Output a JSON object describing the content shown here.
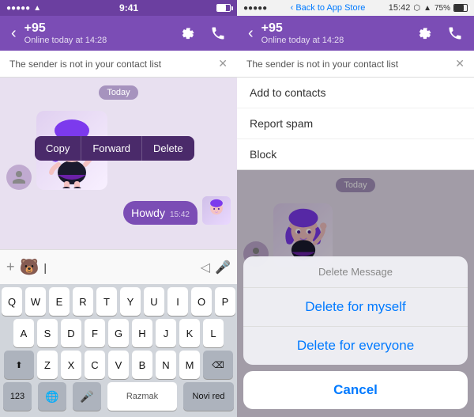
{
  "left": {
    "statusBar": {
      "signal": "●●●●●",
      "time": "9:41",
      "wifi": "WiFi",
      "battery": "battery"
    },
    "header": {
      "back": "‹",
      "contactName": "+95",
      "onlineStatus": "Online today at 14:28",
      "settingsIcon": "⚙",
      "callIcon": "📞"
    },
    "notification": "The sender is not in your contact list",
    "dateBadge": "Today",
    "contextMenu": {
      "copy": "Copy",
      "forward": "Forward",
      "delete": "Delete"
    },
    "outgoingMsg": "Howdy",
    "outgoingTime": "15:42",
    "inputPlaceholder": "|",
    "keyboard": {
      "row1": [
        "Q",
        "W",
        "E",
        "R",
        "T",
        "Y",
        "U",
        "I",
        "O",
        "P"
      ],
      "row2": [
        "A",
        "S",
        "D",
        "F",
        "G",
        "H",
        "J",
        "K",
        "L"
      ],
      "row3": [
        "Z",
        "X",
        "C",
        "V",
        "B",
        "N",
        "M"
      ],
      "spaceLabel": "Razmak",
      "returnLabel": "Novi red"
    }
  },
  "right": {
    "statusBar": {
      "time": "15:42",
      "backToStore": "Back to App Store",
      "bluetooth": "B",
      "wifi": "W",
      "batteryPct": "75%"
    },
    "header": {
      "back": "‹",
      "contactName": "+95",
      "onlineStatus": "Online today at 14:28"
    },
    "notification": "The sender is not in your contact list",
    "dropdownItems": [
      "Add to contacts",
      "Report spam",
      "Block"
    ],
    "dateBadge": "Today",
    "actionSheet": {
      "title": "Delete Message",
      "option1": "Delete for myself",
      "option2": "Delete for everyone",
      "cancel": "Cancel"
    }
  }
}
